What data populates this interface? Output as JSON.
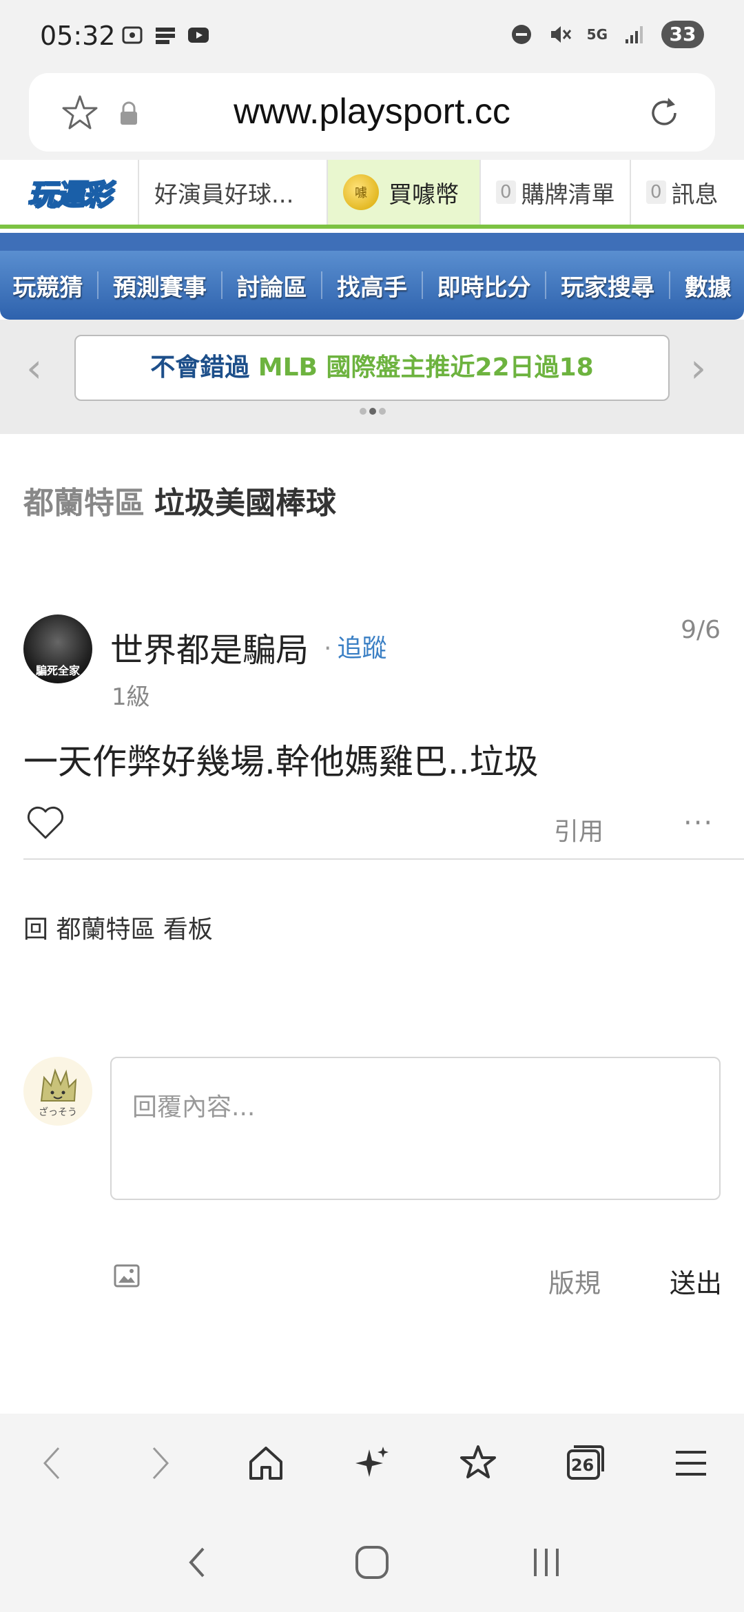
{
  "status_bar": {
    "time": "05:32",
    "network": "5G",
    "battery": "33"
  },
  "browser": {
    "url": "www.playsport.cc",
    "tab_count": "26"
  },
  "top_nav": {
    "logo_text": "玩運彩",
    "items": [
      {
        "label": "好演員好球..."
      },
      {
        "label": "買噱幣",
        "active": true
      },
      {
        "label": "購牌清單",
        "count": "0"
      },
      {
        "label": "訊息",
        "count": "0"
      }
    ]
  },
  "category_nav": {
    "items": [
      "玩競猜",
      "預測賽事",
      "討論區",
      "找高手",
      "即時比分",
      "玩家搜尋",
      "數據"
    ]
  },
  "banner": {
    "part1": "不會錯過 ",
    "part2": "MLB 國際盤主推近22日過18"
  },
  "breadcrumb": {
    "board": "都蘭特區",
    "title": "垃圾美國棒球"
  },
  "post": {
    "author": "世界都是騙局",
    "follow_label": "追蹤",
    "level": "1級",
    "date": "9/6",
    "body": "一天作弊好幾場.幹他媽雞巴..垃圾",
    "quote_label": "引用",
    "more_label": "···",
    "avatar_text": "騙死全家"
  },
  "back_link": "回 都蘭特區 看板",
  "reply": {
    "placeholder": "回覆內容...",
    "avatar_caption": "ざっそう",
    "rules_label": "版規",
    "send_label": "送出"
  },
  "colors": {
    "brand_green": "#7cc242",
    "nav_blue": "#2e62ad",
    "link_blue": "#3a7fc4"
  }
}
